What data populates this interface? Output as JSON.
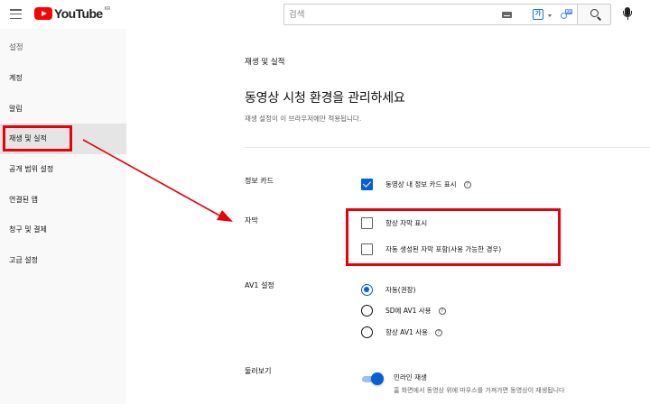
{
  "header": {
    "logo_text": "YouTube",
    "logo_country": "KR",
    "search_placeholder": "검색",
    "translate_glyph": "가",
    "extension_badge": "KO"
  },
  "sidebar": {
    "heading": "설정",
    "items": [
      {
        "label": "계정",
        "active": false
      },
      {
        "label": "알림",
        "active": false
      },
      {
        "label": "재생 및 실적",
        "active": true
      },
      {
        "label": "공개 범위 설정",
        "active": false
      },
      {
        "label": "연결된 앱",
        "active": false
      },
      {
        "label": "청구 및 결제",
        "active": false
      },
      {
        "label": "고급 설정",
        "active": false
      }
    ]
  },
  "main": {
    "breadcrumb": "재생 및 실적",
    "title": "동영상 시청 환경을 관리하세요",
    "subtitle": "재생 설정이 이 브라우저에만 적용됩니다.",
    "info_cards": {
      "label": "정보 카드",
      "option_label": "동영상 내 정보 카드 표시",
      "checked": true
    },
    "captions": {
      "label": "자막",
      "options": [
        {
          "label": "항상 자막 표시",
          "checked": false
        },
        {
          "label": "자동 생성된 자막 포함(사용 가능한 경우)",
          "checked": false
        }
      ]
    },
    "av1": {
      "label": "AV1 설정",
      "options": [
        {
          "label": "자동(권장)",
          "checked": true
        },
        {
          "label": "SD에 AV1 사용",
          "checked": false
        },
        {
          "label": "항상 AV1 사용",
          "checked": false
        }
      ]
    },
    "browsing": {
      "label": "둘러보기",
      "toggle_label": "인라인 재생",
      "toggle_on": true,
      "toggle_desc": "홈 화면에서 동영상 위에 마우스를 가져가면 동영상이 재생됩니다"
    },
    "help_glyph": "?"
  },
  "colors": {
    "accent": "#065fd4",
    "annotation": "#e8000b",
    "sidebar_bg": "#f9f9f9",
    "active_bg": "#e5e5e5"
  },
  "icons": [
    "menu-icon",
    "youtube-logo-icon",
    "keyboard-icon",
    "translate-icon",
    "extension-icon",
    "search-icon",
    "mic-icon",
    "help-icon"
  ]
}
